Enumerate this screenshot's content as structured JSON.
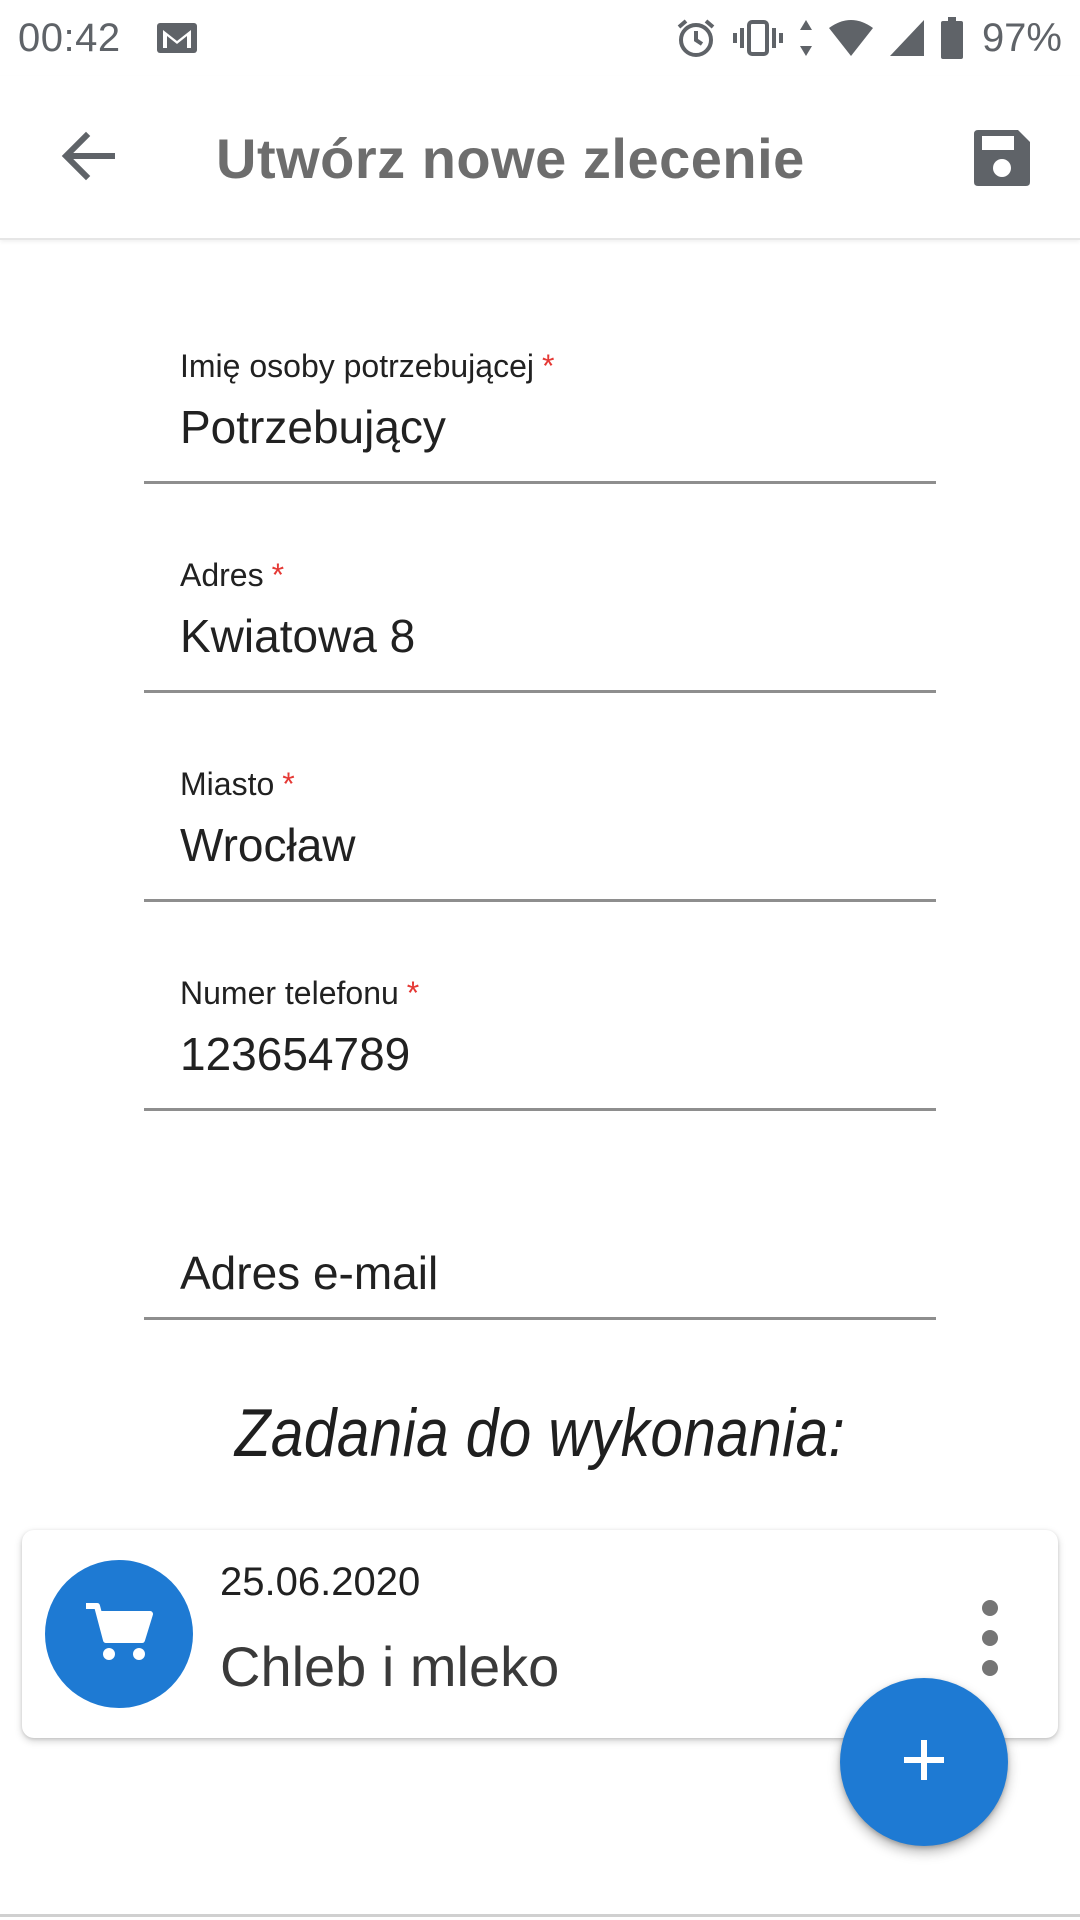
{
  "status_bar": {
    "time": "00:42",
    "battery_percent": "97%",
    "icons": [
      "gmail-icon",
      "alarm-icon",
      "vibrate-icon",
      "data-arrows-icon",
      "wifi-icon",
      "signal-icon",
      "battery-icon"
    ]
  },
  "app_bar": {
    "title": "Utwórz nowe zlecenie",
    "back_icon": "arrow-back-icon",
    "save_icon": "floppy-save-icon"
  },
  "form": {
    "fields": [
      {
        "label": "Imię osoby potrzebującej",
        "required_mark": "*",
        "value": "Potrzebujący"
      },
      {
        "label": "Adres",
        "required_mark": "*",
        "value": "Kwiatowa 8"
      },
      {
        "label": "Miasto",
        "required_mark": "*",
        "value": "Wrocław"
      },
      {
        "label": "Numer telefonu",
        "required_mark": "*",
        "value": "123654789"
      },
      {
        "label": "Adres e-mail",
        "value": ""
      }
    ]
  },
  "tasks_section": {
    "title": "Zadania do wykonania:",
    "items": [
      {
        "date": "25.06.2020",
        "name": "Chleb i mleko",
        "icon": "shopping-cart-icon"
      }
    ]
  },
  "fab": {
    "icon": "plus-icon"
  },
  "colors": {
    "accent": "#1e7ad3",
    "required": "#e53935",
    "title_gray": "#6d6d6d",
    "underline": "#8e8e8e"
  }
}
